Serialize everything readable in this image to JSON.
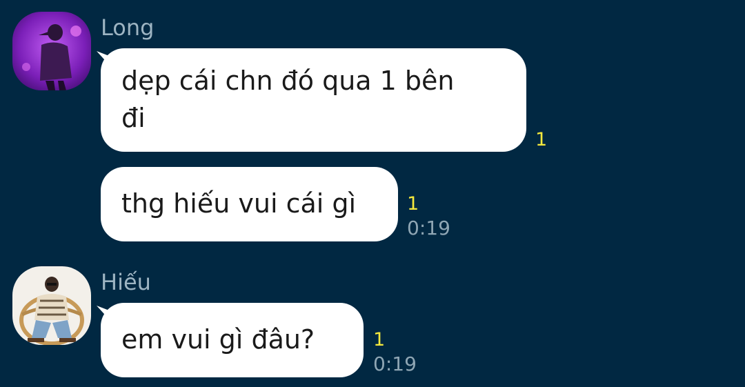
{
  "colors": {
    "background": "#012842",
    "bubble": "#ffffff",
    "bubble_text": "#1a1a1a",
    "sender_name": "#9db4c2",
    "read_count": "#f5e93d",
    "timestamp": "#8fa6b4"
  },
  "groups": [
    {
      "sender": "Long",
      "avatar": "avatar-long",
      "messages": [
        {
          "text": "dẹp cái chn đó qua 1 bên\nđi",
          "read_count": "1",
          "time": ""
        },
        {
          "text": "thg hiếu vui cái gì",
          "read_count": "1",
          "time": "0:19"
        }
      ]
    },
    {
      "sender": "Hiếu",
      "avatar": "avatar-hieu",
      "messages": [
        {
          "text": "em vui gì đâu?",
          "read_count": "1",
          "time": "0:19"
        }
      ]
    }
  ]
}
